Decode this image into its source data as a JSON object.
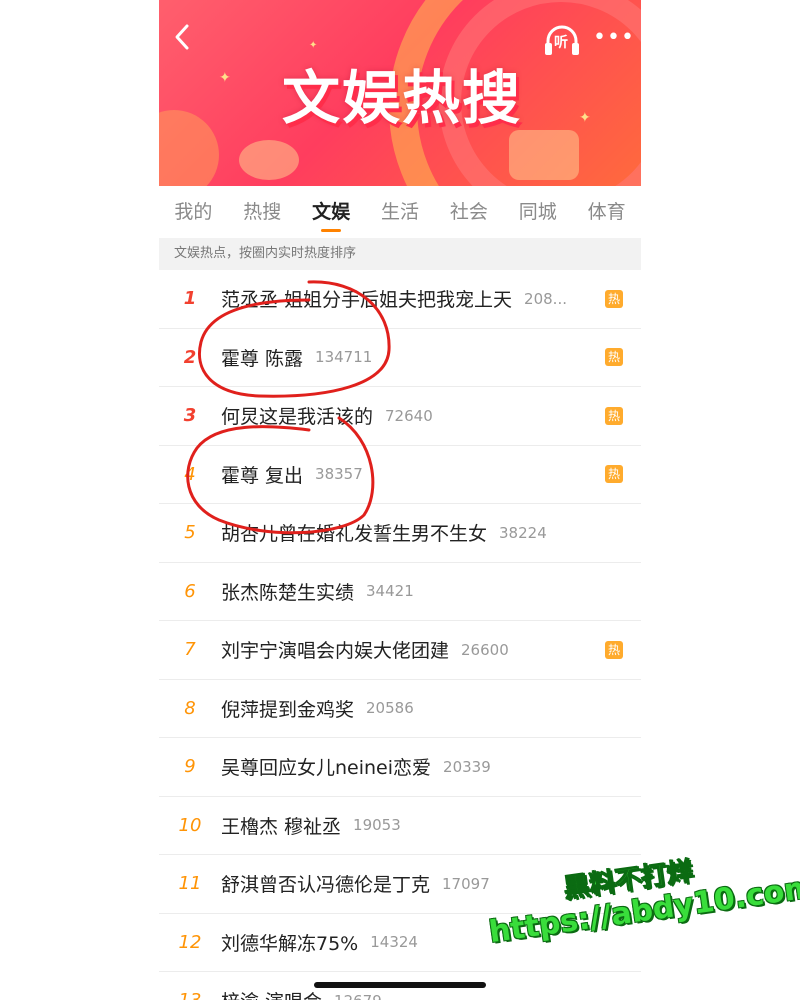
{
  "banner": {
    "title": "文娱热搜",
    "listen_label": "听",
    "more_label": "•••",
    "back_label": "‹"
  },
  "tabs": [
    {
      "label": "我的",
      "active": false
    },
    {
      "label": "热搜",
      "active": false
    },
    {
      "label": "文娱",
      "active": true
    },
    {
      "label": "生活",
      "active": false
    },
    {
      "label": "社会",
      "active": false
    },
    {
      "label": "同城",
      "active": false
    },
    {
      "label": "体育",
      "active": false
    }
  ],
  "notice": "文娱热点，按圈内实时热度排序",
  "items": [
    {
      "rank": "1",
      "title": "范丞丞 姐姐分手后姐夫把我宠上天",
      "count": "208...",
      "hot": "热"
    },
    {
      "rank": "2",
      "title": "霍尊 陈露",
      "count": "134711",
      "hot": "热"
    },
    {
      "rank": "3",
      "title": "何炅这是我活该的",
      "count": "72640",
      "hot": "热"
    },
    {
      "rank": "4",
      "title": "霍尊 复出",
      "count": "38357",
      "hot": "热"
    },
    {
      "rank": "5",
      "title": "胡杏儿曾在婚礼发誓生男不生女",
      "count": "38224",
      "hot": ""
    },
    {
      "rank": "6",
      "title": "张杰陈楚生实绩",
      "count": "34421",
      "hot": ""
    },
    {
      "rank": "7",
      "title": "刘宇宁演唱会内娱大佬团建",
      "count": "26600",
      "hot": "热"
    },
    {
      "rank": "8",
      "title": "倪萍提到金鸡奖",
      "count": "20586",
      "hot": ""
    },
    {
      "rank": "9",
      "title": "吴尊回应女儿neinei恋爱",
      "count": "20339",
      "hot": ""
    },
    {
      "rank": "10",
      "title": "王櫓杰 穆祉丞",
      "count": "19053",
      "hot": ""
    },
    {
      "rank": "11",
      "title": "舒淇曾否认冯德伦是丁克",
      "count": "17097",
      "hot": ""
    },
    {
      "rank": "12",
      "title": "刘德华解冻75%",
      "count": "14324",
      "hot": ""
    },
    {
      "rank": "13",
      "title": "梓渝 演唱会",
      "count": "12679",
      "hot": ""
    }
  ],
  "watermark": {
    "line1": "黑料不打烊",
    "line2": "https://abdy10.com"
  },
  "colors": {
    "accent": "#ff8200",
    "rank_top": "#f2402f",
    "rank_other": "#ff9406",
    "hot_badge": "#ffab2d",
    "annotation": "#e0201c"
  }
}
